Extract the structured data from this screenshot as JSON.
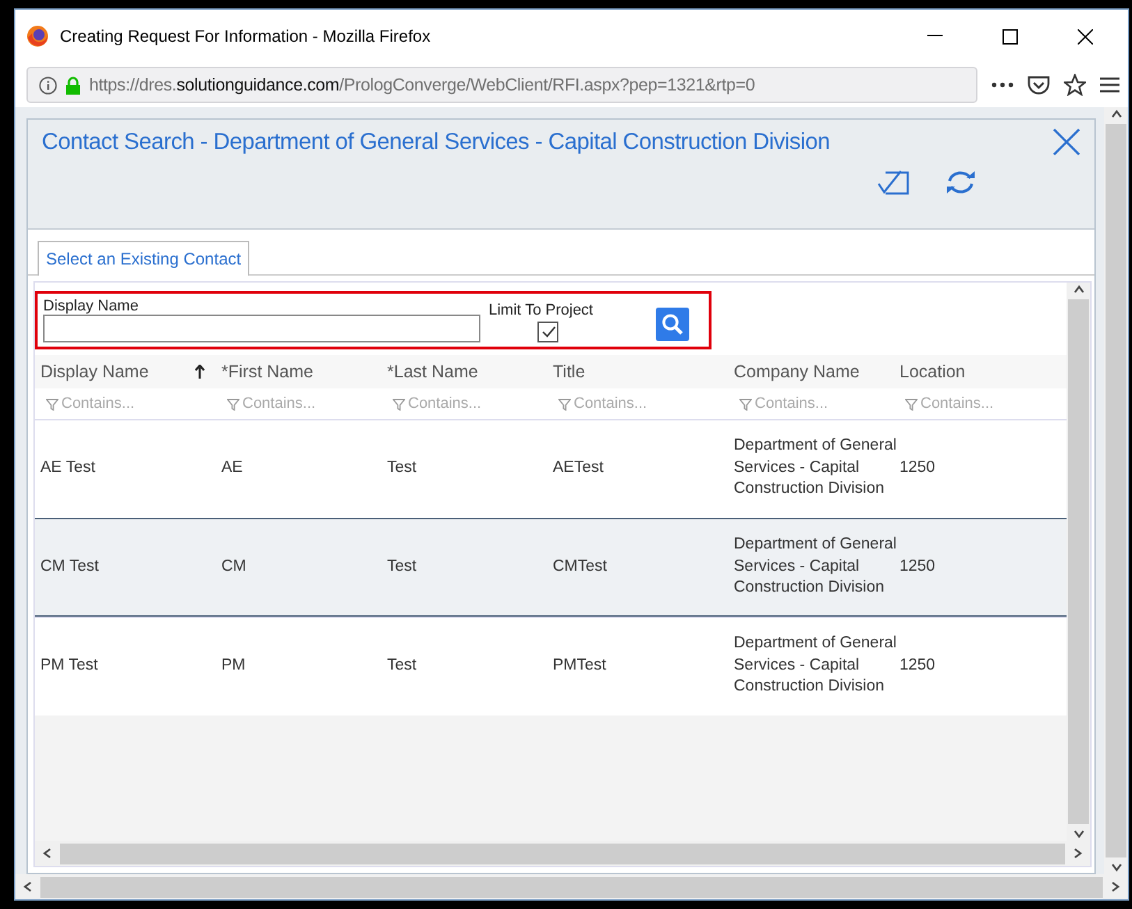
{
  "window": {
    "title": "Creating Request For Information - Mozilla Firefox"
  },
  "address_bar": {
    "url_prefix": "https://dres.",
    "url_domain": "solutionguidance.com",
    "url_path": "/PrologConverge/WebClient/RFI.aspx?pep=1321&rtp=0"
  },
  "dialog": {
    "title": "Contact Search - Department of General Services - Capital Construction Division"
  },
  "tabs": [
    {
      "label": "Select an Existing Contact",
      "selected": true
    }
  ],
  "search": {
    "label": "Display Name",
    "limit_label": "Limit To Project",
    "limit_checked": true,
    "highlighted": true
  },
  "table": {
    "columns": [
      {
        "label": "Display Name",
        "sorted": true,
        "filter_placeholder": "Contains..."
      },
      {
        "label": "*First Name",
        "sorted": false,
        "filter_placeholder": "Contains..."
      },
      {
        "label": "*Last Name",
        "sorted": false,
        "filter_placeholder": "Contains..."
      },
      {
        "label": "Title",
        "sorted": false,
        "filter_placeholder": "Contains..."
      },
      {
        "label": "Company Name",
        "sorted": false,
        "filter_placeholder": "Contains..."
      },
      {
        "label": "Location",
        "sorted": false,
        "filter_placeholder": "Contains..."
      }
    ],
    "rows": [
      {
        "cells": [
          "AE Test",
          "AE",
          "Test",
          "AETest",
          "Department of General Services - Capital Construction Division",
          "1250"
        ],
        "selected": false
      },
      {
        "cells": [
          "CM Test",
          "CM",
          "Test",
          "CMTest",
          "Department of General Services - Capital Construction Division",
          "1250"
        ],
        "selected": true
      },
      {
        "cells": [
          "PM Test",
          "PM",
          "Test",
          "PMTest",
          "Department of General Services - Capital Construction Division",
          "1250"
        ],
        "selected": false
      }
    ]
  }
}
